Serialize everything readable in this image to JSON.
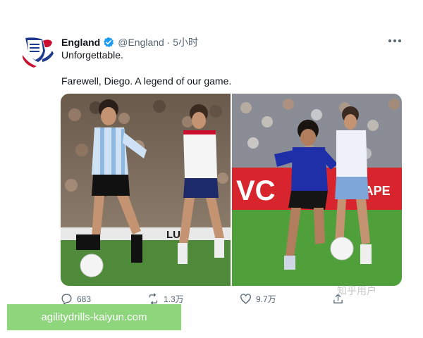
{
  "tweet": {
    "author_name": "England",
    "handle_meta": "@England · 5小时",
    "text_line1": "Unforgettable.",
    "text_line2": "Farewell, Diego. A legend of our game.",
    "more_icon": "more-horizontal-icon",
    "verified_icon": "verified-badge-icon",
    "verified_color": "#1d9bf0"
  },
  "media": {
    "left_photo_banner": "LUB",
    "right_photo_banner": "VC",
    "right_photo_banner_tail": "TAPE"
  },
  "actions": {
    "reply_count": "683",
    "retweet_count": "1.3万",
    "like_count": "9.7万",
    "reply_icon": "reply-icon",
    "retweet_icon": "retweet-icon",
    "like_icon": "heart-icon",
    "share_icon": "share-icon"
  },
  "watermark": {
    "text": "知乎用户"
  },
  "banner": {
    "text": "agilitydrills-kaiyun.com",
    "color": "#8ed67c"
  }
}
